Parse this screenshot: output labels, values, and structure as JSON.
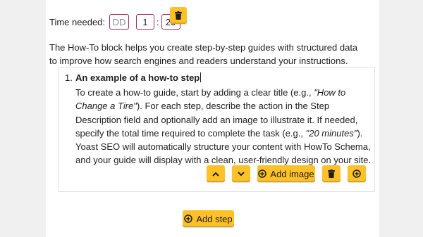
{
  "time": {
    "label": "Time needed:",
    "days_placeholder": "DD",
    "hours_value": "1",
    "separator": ":",
    "minutes_value": "20"
  },
  "intro_text": "The How-To block helps you create step-by-step guides with structured data to improve how search engines and readers understand your instructions.",
  "step": {
    "number": "1.",
    "title": "An example of a how-to step",
    "desc_part1": "To create a how-to guide, start by adding a clear title (e.g., ",
    "desc_em1": "\"How to Change a Tire\"",
    "desc_part2": "). For each step, describe the action in the Step Description field and optionally add an image to illustrate it. If needed, specify the total time required to complete the task (e.g., ",
    "desc_em2": "\"20 minutes\"",
    "desc_part3": "). Yoast SEO will automatically structure your content with HowTo Schema, and your guide will display with a clean, user-friendly design on your site."
  },
  "buttons": {
    "add_image_label": "Add image",
    "add_step_label": "Add step"
  },
  "icons": {
    "trash": "trash-icon",
    "move_up": "chevron-up-icon",
    "move_down": "chevron-down-icon",
    "add_circle": "plus-circle-icon"
  },
  "colors": {
    "button_yellow": "#fec228",
    "input_border": "#a4286a",
    "background": "#f0f0f1"
  }
}
